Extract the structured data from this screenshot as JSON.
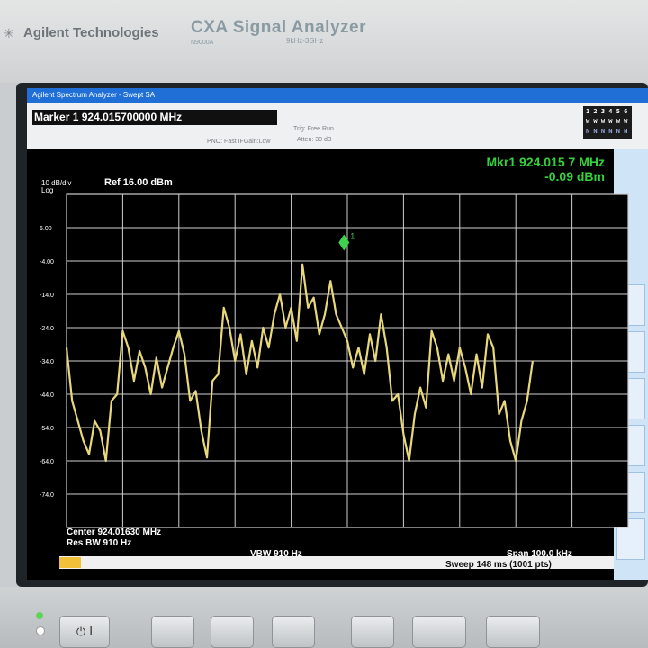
{
  "instrument": {
    "brand": "Agilent Technologies",
    "model": "CXA Signal Analyzer",
    "model_sub": "9kHz-3GHz",
    "model_code": "N9000A"
  },
  "window": {
    "title": "Agilent Spectrum Analyzer - Swept SA"
  },
  "marker_bar": {
    "label": "Marker 1",
    "value": "924.015700000 MHz"
  },
  "info": {
    "trig_line": "Trig: Free Run",
    "atten_line": "Atten: 30 dB",
    "gate_line": "PNO: Fast  IFGain:Low",
    "trace_rows": [
      "1 2 3 4 5 6",
      "W W W W W W",
      "N N N N N N"
    ]
  },
  "readout": {
    "mkr_freq": "Mkr1 924.015 7 MHz",
    "mkr_level": "-0.09 dBm",
    "scale_line1": "10 dB/div",
    "scale_line2": "Log",
    "ref_level": "Ref 16.00 dBm"
  },
  "footer": {
    "center": "Center 924.01630 MHz",
    "res_bw": "Res BW 910 Hz",
    "vbw": "VBW 910 Hz",
    "span": "Span 100.0 kHz",
    "sweep": "Sweep  148 ms (1001 pts)"
  },
  "colors": {
    "trace": "#e8d87a",
    "grid": "#cfcfcf",
    "marker": "#3fd24f",
    "readout": "#35d13a",
    "title_bar": "#1f6fd6"
  },
  "icons": {
    "power": "power-icon",
    "marker": "diamond-marker-icon"
  },
  "chart_data": {
    "type": "line",
    "title": "",
    "xlabel": "",
    "ylabel": "",
    "xlim": [
      923.9663,
      924.0663
    ],
    "ylim": [
      -84,
      16
    ],
    "y_ticks": [
      6.0,
      -4.0,
      -14.0,
      -24.0,
      -34.0,
      -44.0,
      -54.0,
      -64.0,
      -74.0
    ],
    "grid": true,
    "series": [
      {
        "values_x_khz_offset": [
          -50,
          -49,
          -48,
          -47,
          -46,
          -45,
          -44,
          -43,
          -42,
          -41,
          -40,
          -39,
          -38,
          -37,
          -36,
          -35,
          -34,
          -33,
          -32,
          -31,
          -30,
          -29,
          -28,
          -27,
          -26,
          -25,
          -24,
          -23,
          -22,
          -21,
          -20,
          -19,
          -18,
          -17,
          -16,
          -15,
          -14,
          -13,
          -12,
          -11,
          -10,
          -9,
          -8,
          -7,
          -6,
          -5,
          -4,
          -3,
          -2,
          -1,
          0,
          1,
          2,
          3,
          4,
          5,
          6,
          7,
          8,
          9,
          10,
          11,
          12,
          13,
          14,
          15,
          16,
          17,
          18,
          19,
          20,
          21,
          22,
          23,
          24,
          25,
          26,
          27,
          28,
          29,
          30,
          31,
          32,
          33,
          34,
          35,
          36,
          37,
          38,
          39,
          40,
          41,
          42,
          43,
          44,
          45,
          46,
          47,
          48,
          49,
          50
        ],
        "values": [
          -30,
          -46,
          -52,
          -58,
          -62,
          -52,
          -55,
          -64,
          -46,
          -44,
          -25,
          -30,
          -40,
          -31,
          -36,
          -44,
          -33,
          -42,
          -36,
          -30,
          -25,
          -32,
          -46,
          -43,
          -55,
          -63,
          -40,
          -38,
          -18,
          -24,
          -34,
          -26,
          -38,
          -28,
          -36,
          -24,
          -30,
          -20,
          -14,
          -24,
          -18,
          -28,
          -5,
          -18,
          -15,
          -26,
          -20,
          -10,
          -20,
          -24,
          -28,
          -36,
          -30,
          -38,
          -26,
          -34,
          -20,
          -30,
          -46,
          -44,
          -56,
          -64,
          -50,
          -42,
          -48,
          -25,
          -30,
          -40,
          -32,
          -40,
          -30,
          -36,
          -44,
          -32,
          -42,
          -26,
          -30,
          -50,
          -46,
          -58,
          -64,
          -52,
          -46,
          -34
        ]
      }
    ],
    "marker": {
      "x_mhz": 924.0157,
      "y_dbm": -0.09,
      "label": "1"
    }
  }
}
